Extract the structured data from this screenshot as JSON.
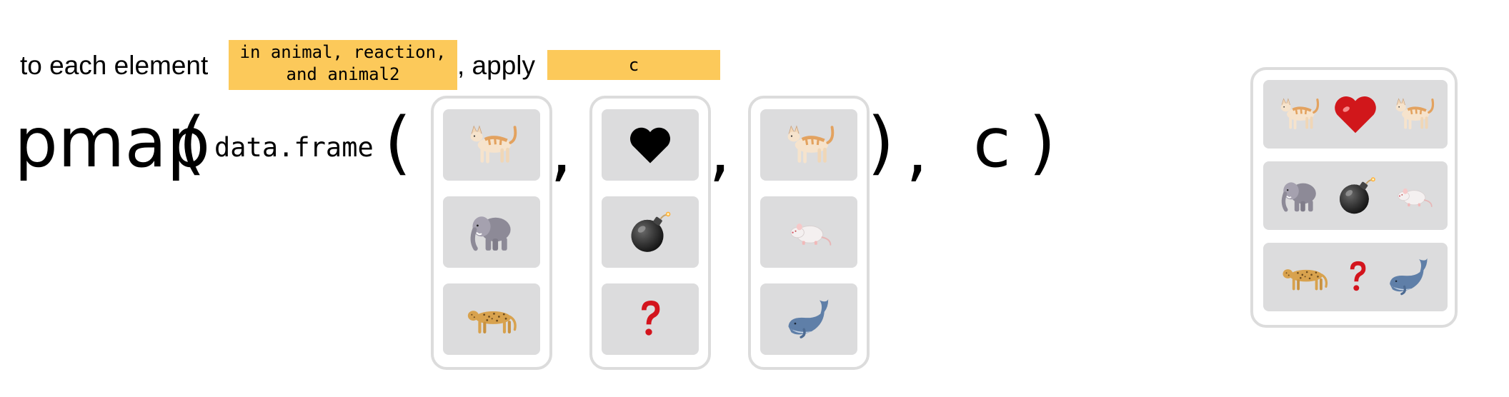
{
  "sentence": {
    "prefix": "to each element",
    "highlight1": "in animal, reaction,\nand animal2",
    "middle": ", apply",
    "highlight2": "c"
  },
  "code": {
    "func": "pmap",
    "open_paren": "(",
    "constructor": "data.frame",
    "comma": ",",
    "close_paren": ")",
    "fn_arg": "c"
  },
  "input_columns": [
    {
      "icons": [
        "cat-icon",
        "elephant-icon",
        "leopard-icon"
      ]
    },
    {
      "icons": [
        "black-heart-icon",
        "bomb-icon",
        "question-mark-icon"
      ]
    },
    {
      "icons": [
        "cat-icon",
        "rat-icon",
        "whale-icon"
      ]
    }
  ],
  "output_rows": [
    {
      "icons": [
        "cat-icon",
        "red-heart-icon",
        "cat-icon"
      ]
    },
    {
      "icons": [
        "elephant-icon",
        "bomb-icon",
        "rat-icon"
      ]
    },
    {
      "icons": [
        "leopard-icon",
        "question-mark-icon",
        "whale-icon"
      ]
    }
  ],
  "colors": {
    "highlight": "#fcc95a",
    "cell": "#dcdcdd",
    "border": "#dcdcdc"
  }
}
